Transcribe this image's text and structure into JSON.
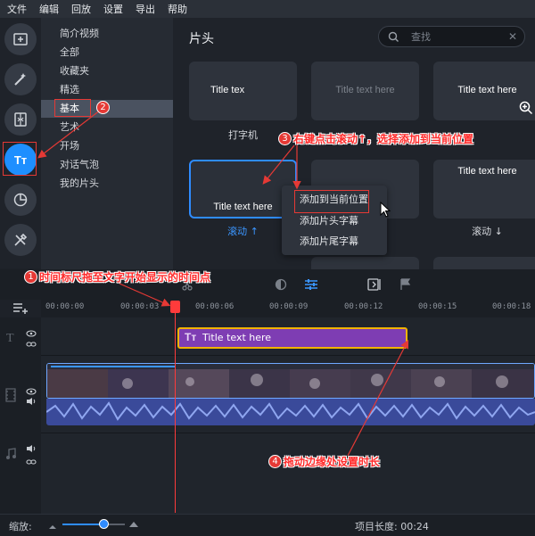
{
  "menu": [
    "文件",
    "编辑",
    "回放",
    "设置",
    "导出",
    "帮助"
  ],
  "left_tools": [
    {
      "name": "import-media-icon"
    },
    {
      "name": "magic-wand-icon"
    },
    {
      "name": "transitions-icon"
    },
    {
      "name": "titles-icon",
      "label": "Tт",
      "active": true
    },
    {
      "name": "stickers-icon"
    },
    {
      "name": "tools-icon"
    }
  ],
  "categories": [
    "简介视频",
    "全部",
    "收藏夹",
    "精选",
    "基本",
    "艺术",
    "开场",
    "对话气泡",
    "我的片头"
  ],
  "selected_category": "基本",
  "section_title": "片头",
  "search": {
    "placeholder": "查找"
  },
  "thumbs": [
    {
      "text": "Title tex",
      "label": "打字机"
    },
    {
      "text": "Title text here",
      "label": ""
    },
    {
      "text": "Title text here",
      "label": ""
    },
    {
      "text": "Title text here",
      "label": "滚动 ↑"
    },
    {
      "text": "",
      "label": ""
    },
    {
      "text": "Title text here",
      "label": "滚动 ↓"
    }
  ],
  "context_menu": [
    "添加到当前位置",
    "添加片头字幕",
    "添加片尾字幕"
  ],
  "annotations": {
    "a1": {
      "num": "1",
      "text": "时间标尺拖至文字开始显示的时间点"
    },
    "a2": {
      "num": "2",
      "text": ""
    },
    "a3": {
      "num": "3",
      "text": "右键点击滚动↑，选择添加到当前位置"
    },
    "a4": {
      "num": "4",
      "text": "拖动边缘处设置时长"
    }
  },
  "timeline": {
    "ticks": [
      "00:00:00",
      "00:00:03",
      "00:00:06",
      "00:00:09",
      "00:00:12",
      "00:00:15",
      "00:00:18"
    ],
    "title_clip": "Title text here",
    "title_icon": "Tт"
  },
  "status": {
    "zoom_label": "缩放:",
    "zoom_level": 0.66,
    "project_length": "项目长度: 00:24"
  },
  "colors": {
    "accent": "#1e8fff",
    "annotation": "#e53935",
    "title_clip": "#7e3db3",
    "clip_border": "#f2b300"
  }
}
